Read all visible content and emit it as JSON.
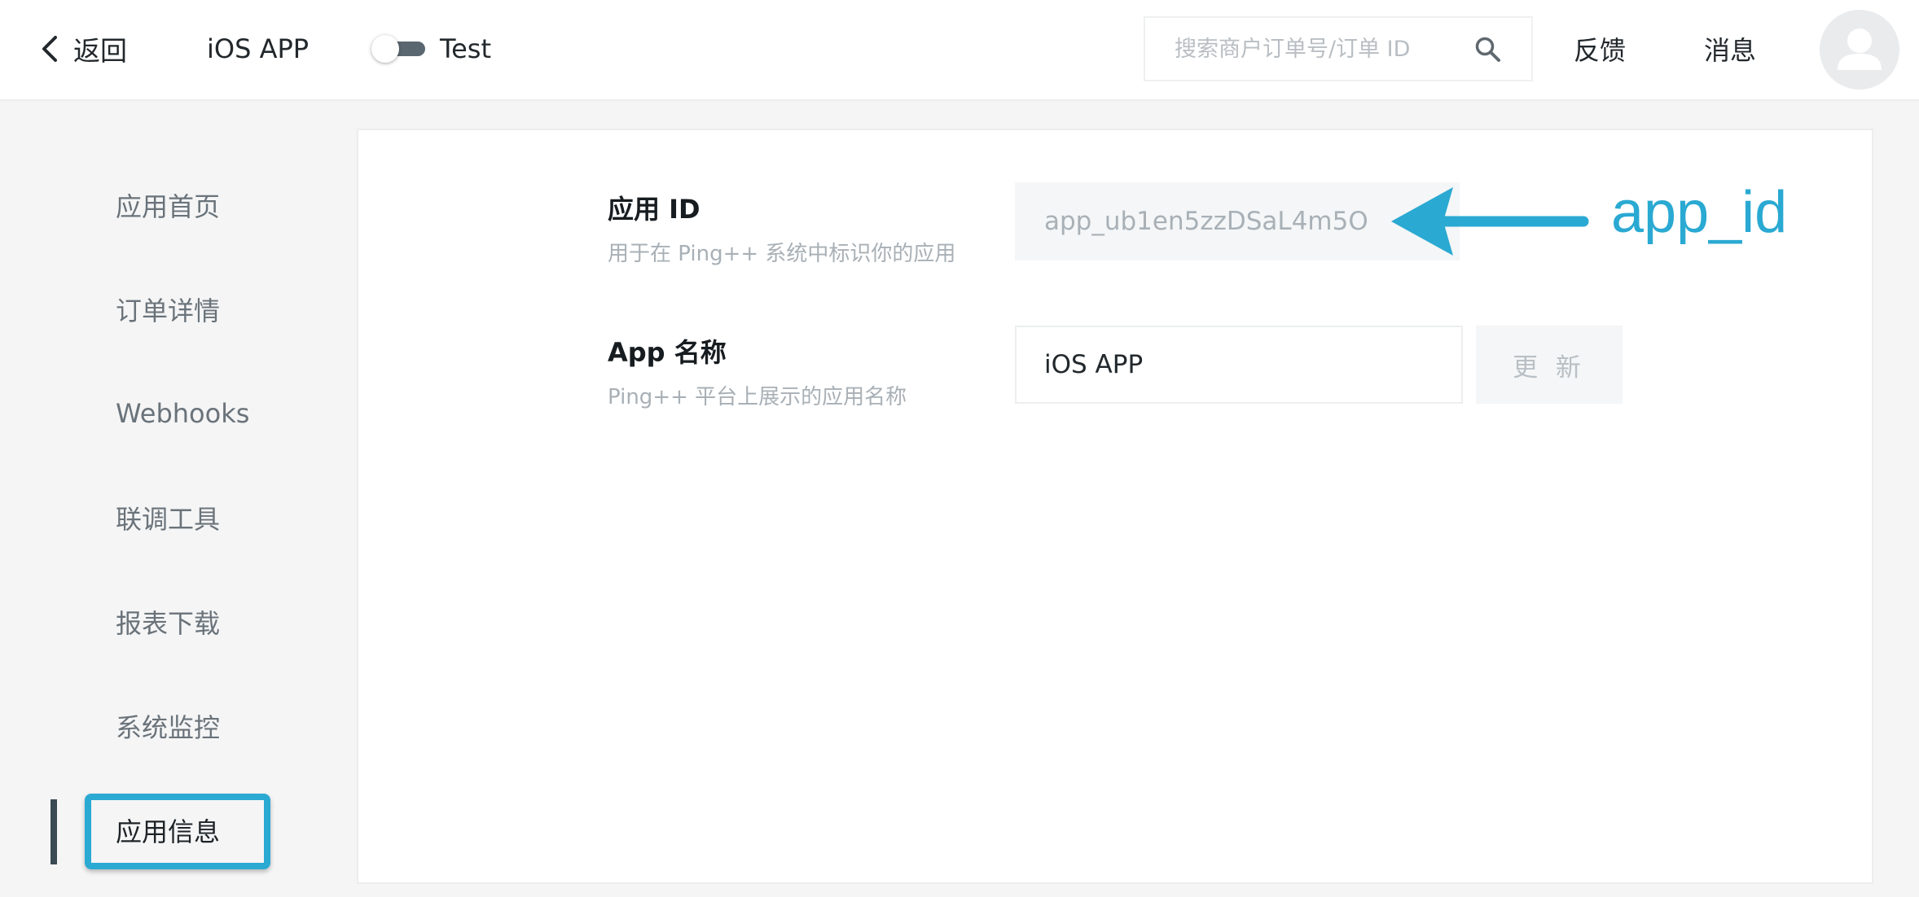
{
  "header": {
    "back_label": "返回",
    "app_name": "iOS APP",
    "mode_label": "Test",
    "mode_toggle_on": false,
    "search_placeholder": "搜索商户订单号/订单 ID",
    "search_value": "",
    "feedback_label": "反馈",
    "messages_label": "消息"
  },
  "sidebar": {
    "items": [
      {
        "label": "应用首页",
        "active": false
      },
      {
        "label": "订单详情",
        "active": false
      },
      {
        "label": "Webhooks",
        "active": false
      },
      {
        "label": "联调工具",
        "active": false
      },
      {
        "label": "报表下载",
        "active": false
      },
      {
        "label": "系统监控",
        "active": false
      },
      {
        "label": "应用信息",
        "active": true
      }
    ]
  },
  "main": {
    "app_id": {
      "title": "应用 ID",
      "description": "用于在 Ping++ 系统中标识你的应用",
      "value": "app_ub1en5zzDSaL4m5O"
    },
    "app_name": {
      "title": "App 名称",
      "description": "Ping++ 平台上展示的应用名称",
      "value": "iOS APP",
      "update_label": "更 新"
    }
  },
  "annotation": {
    "label": "app_id",
    "color": "#2aa9d2"
  },
  "colors": {
    "accent": "#2aa9d2",
    "sidebar_active_bar": "#3b4a54",
    "toggle_track": "#5b6770"
  }
}
